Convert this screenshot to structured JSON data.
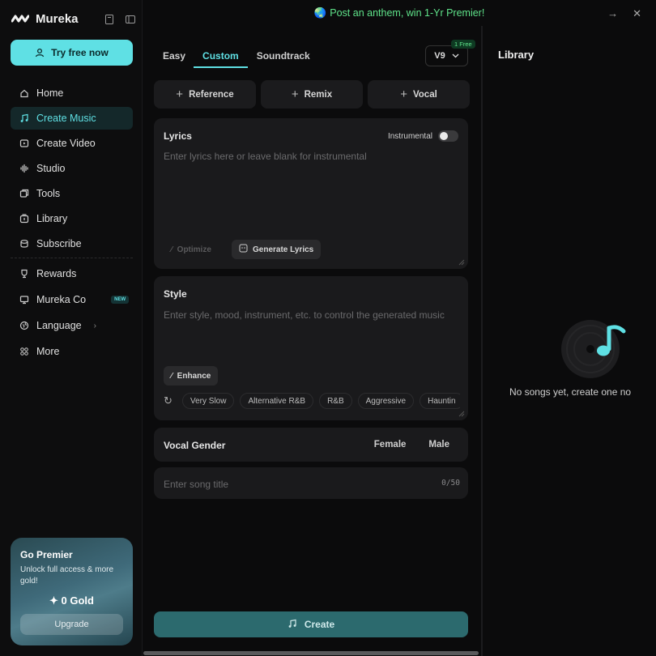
{
  "sidebar": {
    "brand": "Mureka",
    "try_button": "Try free now",
    "nav": [
      {
        "label": "Home",
        "icon": "home-icon"
      },
      {
        "label": "Create Music",
        "icon": "music-note-icon",
        "active": true
      },
      {
        "label": "Create Video",
        "icon": "video-icon"
      },
      {
        "label": "Studio",
        "icon": "waveform-icon"
      },
      {
        "label": "Tools",
        "icon": "tools-icon"
      },
      {
        "label": "Library",
        "icon": "library-icon"
      },
      {
        "label": "Subscribe",
        "icon": "subscribe-icon"
      }
    ],
    "nav_secondary": [
      {
        "label": "Rewards",
        "icon": "trophy-icon"
      },
      {
        "label": "Mureka Co",
        "icon": "monitor-icon",
        "badge": "NEW"
      },
      {
        "label": "Language",
        "icon": "globe-icon"
      },
      {
        "label": "More",
        "icon": "grid-icon"
      }
    ],
    "premier": {
      "title": "Go Premier",
      "subtitle": "Unlock full access & more gold!",
      "gold": "0 Gold",
      "upgrade": "Upgrade"
    }
  },
  "banner": {
    "text": "Post an anthem, win 1-Yr Premier!",
    "icon": "globe-emoji-icon"
  },
  "main": {
    "tabs": [
      {
        "label": "Easy"
      },
      {
        "label": "Custom",
        "active": true
      },
      {
        "label": "Soundtrack"
      }
    ],
    "version": "V9",
    "free_badge": "1 Free",
    "mode_buttons": [
      "Reference",
      "Remix",
      "Vocal"
    ],
    "lyrics": {
      "label": "Lyrics",
      "placeholder": "Enter lyrics here or leave blank for instrumental",
      "instrumental": "Instrumental",
      "optimize": "Optimize",
      "generate": "Generate Lyrics"
    },
    "style": {
      "label": "Style",
      "placeholder": "Enter style, mood, instrument, etc. to control the generated music",
      "enhance": "Enhance",
      "chips": [
        "Very Slow",
        "Alternative R&B",
        "R&B",
        "Aggressive",
        "Hauntin"
      ]
    },
    "vocal": {
      "label": "Vocal Gender",
      "options": [
        "Female",
        "Male"
      ]
    },
    "song_title": {
      "placeholder": "Enter song title",
      "counter": "0/50"
    },
    "create": "Create"
  },
  "library": {
    "title": "Library",
    "empty": "No songs yet, create one no"
  },
  "colors": {
    "accent": "#5fe0e4",
    "banner": "#5fe38a",
    "create_bg": "#2c6a6e"
  }
}
